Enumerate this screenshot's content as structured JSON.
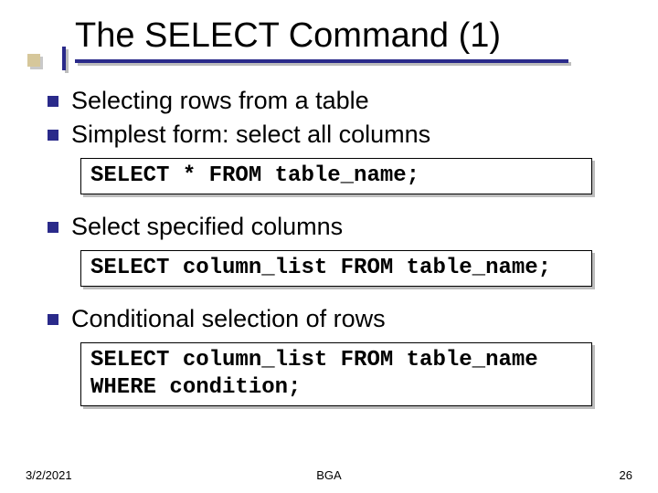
{
  "title": "The SELECT Command (1)",
  "bullets": [
    {
      "text": "Selecting rows from a table"
    },
    {
      "text": "Simplest form: select all columns"
    }
  ],
  "code1": "SELECT * FROM table_name;",
  "bullet3": "Select specified columns",
  "code2": "SELECT column_list FROM table_name;",
  "bullet4": "Conditional selection of rows",
  "code3": "SELECT column_list FROM table_name\nWHERE condition;",
  "footer": {
    "date": "3/2/2021",
    "center": "BGA",
    "page": "26"
  }
}
